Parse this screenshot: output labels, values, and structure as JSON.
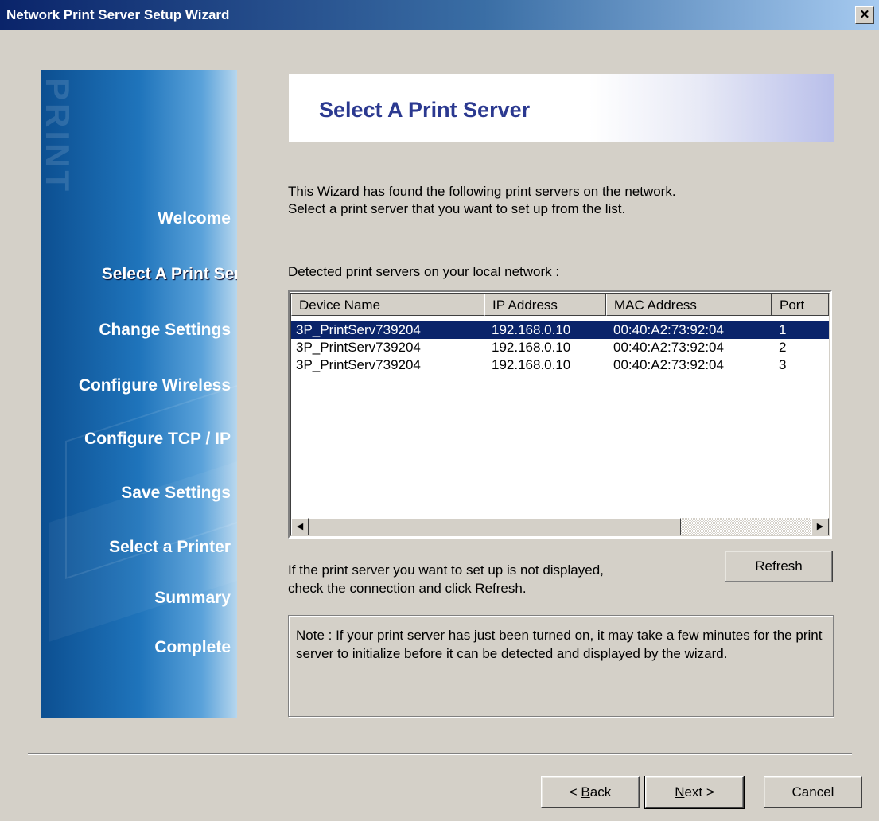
{
  "window": {
    "title": "Network Print Server Setup Wizard",
    "close_glyph": "✕"
  },
  "sidebar": {
    "watermark": "PRINT",
    "steps": [
      {
        "label": "Welcome",
        "active": false
      },
      {
        "label": "Select A Print Server",
        "active": true
      },
      {
        "label": "Change Settings",
        "active": false
      },
      {
        "label": "Configure Wireless",
        "active": false
      },
      {
        "label": "Configure TCP / IP",
        "active": false
      },
      {
        "label": "Save Settings",
        "active": false
      },
      {
        "label": "Select a Printer",
        "active": false
      },
      {
        "label": "Summary",
        "active": false
      },
      {
        "label": "Complete",
        "active": false
      }
    ]
  },
  "main": {
    "title": "Select A Print Server",
    "intro_line1": "This Wizard has found the following print servers on the network.",
    "intro_line2": "Select a print server that you want to set up from the list.",
    "list_label": "Detected print servers on your local network :",
    "columns": [
      "Device Name",
      "IP Address",
      "MAC Address",
      "Port"
    ],
    "rows": [
      {
        "device": "3P_PrintServ739204",
        "ip": "192.168.0.10",
        "mac": "00:40:A2:73:92:04",
        "port": "1",
        "selected": true
      },
      {
        "device": "3P_PrintServ739204",
        "ip": "192.168.0.10",
        "mac": "00:40:A2:73:92:04",
        "port": "2",
        "selected": false
      },
      {
        "device": "3P_PrintServ739204",
        "ip": "192.168.0.10",
        "mac": "00:40:A2:73:92:04",
        "port": "3",
        "selected": false
      }
    ],
    "scroll_left_glyph": "◀",
    "scroll_right_glyph": "▶",
    "refresh_hint_line1": "If the print server you want to set up is not displayed,",
    "refresh_hint_line2": "check the connection and click Refresh.",
    "refresh_label": "Refresh",
    "note": "Note : If your print server has just been turned on, it may take a few minutes for the print server to initialize before it can be detected and displayed by the wizard."
  },
  "footer": {
    "back_prefix": "< ",
    "back_mnemonic": "B",
    "back_rest": "ack",
    "next_mnemonic": "N",
    "next_rest": "ext >",
    "cancel_label": "Cancel"
  },
  "colors": {
    "title_gradient_start": "#0a246a",
    "sidebar_blue": "#1f74bb",
    "header_title": "#2b3990",
    "selection": "#0a246a",
    "dialog_face": "#d4d0c8"
  }
}
